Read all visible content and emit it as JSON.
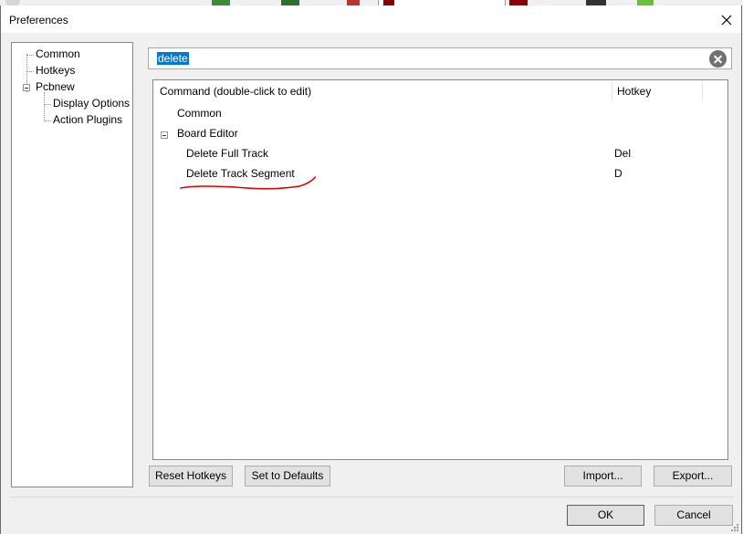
{
  "dialog": {
    "title": "Preferences"
  },
  "tree": {
    "items": [
      {
        "label": "Common"
      },
      {
        "label": "Hotkeys"
      },
      {
        "label": "Pcbnew"
      },
      {
        "label": "Display Options"
      },
      {
        "label": "Action Plugins"
      }
    ]
  },
  "search": {
    "value": "delete"
  },
  "grid": {
    "columns": [
      "Command (double-click to edit)",
      "Hotkey"
    ],
    "rows": [
      {
        "command": "Common",
        "hotkey": ""
      },
      {
        "command": "Board Editor",
        "hotkey": ""
      },
      {
        "command": "Delete Full Track",
        "hotkey": "Del"
      },
      {
        "command": "Delete Track Segment",
        "hotkey": "D"
      }
    ]
  },
  "buttons": {
    "reset_hotkeys": "Reset Hotkeys",
    "set_to_defaults": "Set to Defaults",
    "import": "Import...",
    "export": "Export...",
    "ok": "OK",
    "cancel": "Cancel"
  },
  "colors": {
    "selection": "#0078d7",
    "annotation": "#e00000"
  },
  "icons": [
    "close-icon",
    "clear-search-icon",
    "collapse-icon",
    "resize-grip-icon"
  ]
}
